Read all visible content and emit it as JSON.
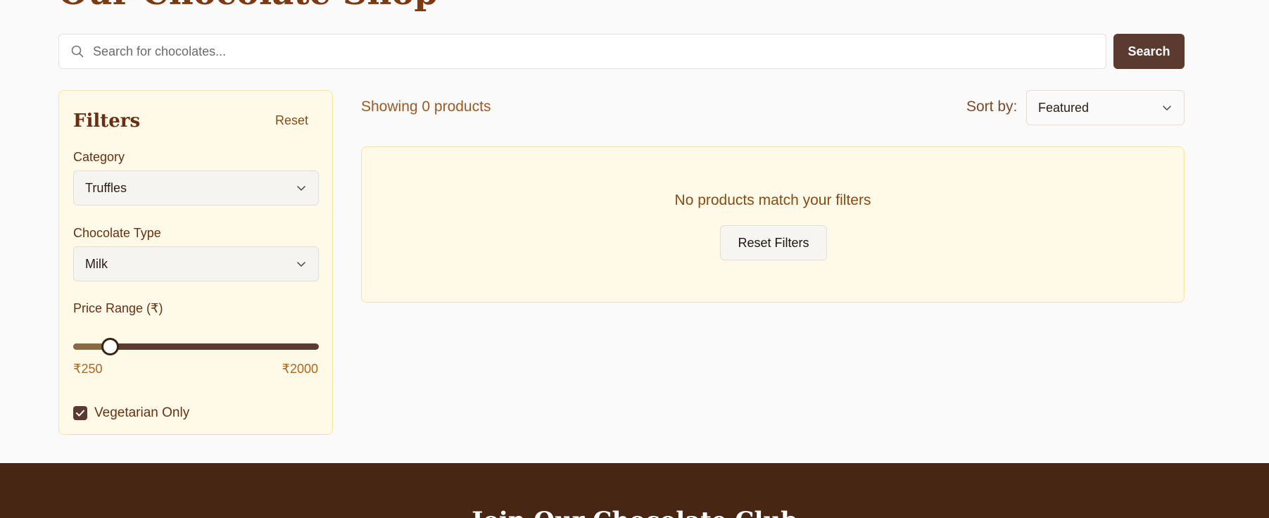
{
  "page": {
    "title": "Our Chocolate Shop"
  },
  "search": {
    "placeholder": "Search for chocolates...",
    "value": "",
    "button_label": "Search",
    "icon": "search-icon"
  },
  "filters": {
    "title": "Filters",
    "reset_label": "Reset",
    "category": {
      "label": "Category",
      "selected": "Truffles"
    },
    "chocolate_type": {
      "label": "Chocolate Type",
      "selected": "Milk"
    },
    "price_range": {
      "label": "Price Range (₹)",
      "min_label": "₹250",
      "max_label": "₹2000",
      "value_fraction": 0.15
    },
    "vegetarian": {
      "label": "Vegetarian Only",
      "checked": true
    }
  },
  "results": {
    "showing_text": "Showing 0 products",
    "sort_label": "Sort by:",
    "sort_selected": "Featured",
    "empty_message": "No products match your filters",
    "reset_filters_label": "Reset Filters"
  },
  "footer": {
    "title": "Join Our Chocolate Club"
  },
  "colors": {
    "brand_dark": "#5b3a30",
    "footer_bg": "#472714",
    "panel_bg": "#fffae8",
    "panel_border": "#f8e3a4"
  }
}
